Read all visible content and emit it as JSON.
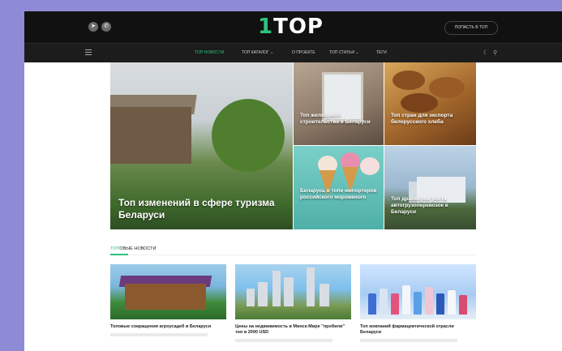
{
  "header": {
    "logo_digit": "1",
    "logo_text": "TOP",
    "cta_label": "ПОПАСТЬ В ТОП",
    "social_icons": [
      "telegram-icon",
      "whatsapp-icon"
    ]
  },
  "nav": {
    "items": [
      {
        "label": "ТОП НОВОСТИ",
        "active": true
      },
      {
        "label": "ТОП КАТАЛОГ ⌄",
        "active": false
      },
      {
        "label": "О ПРОЕКТЕ",
        "active": false
      },
      {
        "label": "ТОП СТАТЬИ ⌄",
        "active": false
      },
      {
        "label": "ТЕГИ",
        "active": false
      }
    ],
    "icons": [
      "menu-icon",
      "theme-icon",
      "search-icon"
    ]
  },
  "featured": {
    "big": "Топ изменений в сфере туризма Беларуси",
    "tiles": [
      "Топ жилищного строительства в Беларуси",
      "Топ стран для экспорта белорусского хлеба",
      "Беларусь в топе импортеров российского мороженого",
      "Топ драйверов роста автогрузоперевозок в Беларуси"
    ]
  },
  "section": {
    "title_highlight": "ТОП",
    "title_rest": "ОВЫЕ НОВОСТИ"
  },
  "cards": [
    {
      "title": "Топовые сокращения агроусадеб в Беларуси"
    },
    {
      "title": "Цены на недвижимость в Минск-Мире \"пробили\" топ в 2000 USD"
    },
    {
      "title": "Топ компаний фармацевтической отрасли Беларуси"
    }
  ],
  "colors": {
    "accent": "#2ec27e",
    "header_bg": "#111111",
    "frame_bg": "#8f8ad6"
  }
}
